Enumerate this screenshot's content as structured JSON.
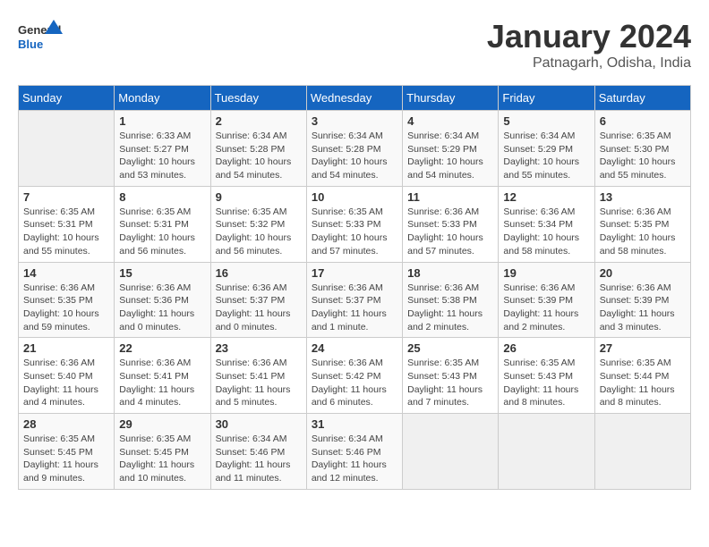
{
  "header": {
    "logo_general": "General",
    "logo_blue": "Blue",
    "month": "January 2024",
    "location": "Patnagarh, Odisha, India"
  },
  "days_of_week": [
    "Sunday",
    "Monday",
    "Tuesday",
    "Wednesday",
    "Thursday",
    "Friday",
    "Saturday"
  ],
  "weeks": [
    [
      {
        "num": "",
        "sunrise": "",
        "sunset": "",
        "daylight": ""
      },
      {
        "num": "1",
        "sunrise": "Sunrise: 6:33 AM",
        "sunset": "Sunset: 5:27 PM",
        "daylight": "Daylight: 10 hours and 53 minutes."
      },
      {
        "num": "2",
        "sunrise": "Sunrise: 6:34 AM",
        "sunset": "Sunset: 5:28 PM",
        "daylight": "Daylight: 10 hours and 54 minutes."
      },
      {
        "num": "3",
        "sunrise": "Sunrise: 6:34 AM",
        "sunset": "Sunset: 5:28 PM",
        "daylight": "Daylight: 10 hours and 54 minutes."
      },
      {
        "num": "4",
        "sunrise": "Sunrise: 6:34 AM",
        "sunset": "Sunset: 5:29 PM",
        "daylight": "Daylight: 10 hours and 54 minutes."
      },
      {
        "num": "5",
        "sunrise": "Sunrise: 6:34 AM",
        "sunset": "Sunset: 5:29 PM",
        "daylight": "Daylight: 10 hours and 55 minutes."
      },
      {
        "num": "6",
        "sunrise": "Sunrise: 6:35 AM",
        "sunset": "Sunset: 5:30 PM",
        "daylight": "Daylight: 10 hours and 55 minutes."
      }
    ],
    [
      {
        "num": "7",
        "sunrise": "Sunrise: 6:35 AM",
        "sunset": "Sunset: 5:31 PM",
        "daylight": "Daylight: 10 hours and 55 minutes."
      },
      {
        "num": "8",
        "sunrise": "Sunrise: 6:35 AM",
        "sunset": "Sunset: 5:31 PM",
        "daylight": "Daylight: 10 hours and 56 minutes."
      },
      {
        "num": "9",
        "sunrise": "Sunrise: 6:35 AM",
        "sunset": "Sunset: 5:32 PM",
        "daylight": "Daylight: 10 hours and 56 minutes."
      },
      {
        "num": "10",
        "sunrise": "Sunrise: 6:35 AM",
        "sunset": "Sunset: 5:33 PM",
        "daylight": "Daylight: 10 hours and 57 minutes."
      },
      {
        "num": "11",
        "sunrise": "Sunrise: 6:36 AM",
        "sunset": "Sunset: 5:33 PM",
        "daylight": "Daylight: 10 hours and 57 minutes."
      },
      {
        "num": "12",
        "sunrise": "Sunrise: 6:36 AM",
        "sunset": "Sunset: 5:34 PM",
        "daylight": "Daylight: 10 hours and 58 minutes."
      },
      {
        "num": "13",
        "sunrise": "Sunrise: 6:36 AM",
        "sunset": "Sunset: 5:35 PM",
        "daylight": "Daylight: 10 hours and 58 minutes."
      }
    ],
    [
      {
        "num": "14",
        "sunrise": "Sunrise: 6:36 AM",
        "sunset": "Sunset: 5:35 PM",
        "daylight": "Daylight: 10 hours and 59 minutes."
      },
      {
        "num": "15",
        "sunrise": "Sunrise: 6:36 AM",
        "sunset": "Sunset: 5:36 PM",
        "daylight": "Daylight: 11 hours and 0 minutes."
      },
      {
        "num": "16",
        "sunrise": "Sunrise: 6:36 AM",
        "sunset": "Sunset: 5:37 PM",
        "daylight": "Daylight: 11 hours and 0 minutes."
      },
      {
        "num": "17",
        "sunrise": "Sunrise: 6:36 AM",
        "sunset": "Sunset: 5:37 PM",
        "daylight": "Daylight: 11 hours and 1 minute."
      },
      {
        "num": "18",
        "sunrise": "Sunrise: 6:36 AM",
        "sunset": "Sunset: 5:38 PM",
        "daylight": "Daylight: 11 hours and 2 minutes."
      },
      {
        "num": "19",
        "sunrise": "Sunrise: 6:36 AM",
        "sunset": "Sunset: 5:39 PM",
        "daylight": "Daylight: 11 hours and 2 minutes."
      },
      {
        "num": "20",
        "sunrise": "Sunrise: 6:36 AM",
        "sunset": "Sunset: 5:39 PM",
        "daylight": "Daylight: 11 hours and 3 minutes."
      }
    ],
    [
      {
        "num": "21",
        "sunrise": "Sunrise: 6:36 AM",
        "sunset": "Sunset: 5:40 PM",
        "daylight": "Daylight: 11 hours and 4 minutes."
      },
      {
        "num": "22",
        "sunrise": "Sunrise: 6:36 AM",
        "sunset": "Sunset: 5:41 PM",
        "daylight": "Daylight: 11 hours and 4 minutes."
      },
      {
        "num": "23",
        "sunrise": "Sunrise: 6:36 AM",
        "sunset": "Sunset: 5:41 PM",
        "daylight": "Daylight: 11 hours and 5 minutes."
      },
      {
        "num": "24",
        "sunrise": "Sunrise: 6:36 AM",
        "sunset": "Sunset: 5:42 PM",
        "daylight": "Daylight: 11 hours and 6 minutes."
      },
      {
        "num": "25",
        "sunrise": "Sunrise: 6:35 AM",
        "sunset": "Sunset: 5:43 PM",
        "daylight": "Daylight: 11 hours and 7 minutes."
      },
      {
        "num": "26",
        "sunrise": "Sunrise: 6:35 AM",
        "sunset": "Sunset: 5:43 PM",
        "daylight": "Daylight: 11 hours and 8 minutes."
      },
      {
        "num": "27",
        "sunrise": "Sunrise: 6:35 AM",
        "sunset": "Sunset: 5:44 PM",
        "daylight": "Daylight: 11 hours and 8 minutes."
      }
    ],
    [
      {
        "num": "28",
        "sunrise": "Sunrise: 6:35 AM",
        "sunset": "Sunset: 5:45 PM",
        "daylight": "Daylight: 11 hours and 9 minutes."
      },
      {
        "num": "29",
        "sunrise": "Sunrise: 6:35 AM",
        "sunset": "Sunset: 5:45 PM",
        "daylight": "Daylight: 11 hours and 10 minutes."
      },
      {
        "num": "30",
        "sunrise": "Sunrise: 6:34 AM",
        "sunset": "Sunset: 5:46 PM",
        "daylight": "Daylight: 11 hours and 11 minutes."
      },
      {
        "num": "31",
        "sunrise": "Sunrise: 6:34 AM",
        "sunset": "Sunset: 5:46 PM",
        "daylight": "Daylight: 11 hours and 12 minutes."
      },
      {
        "num": "",
        "sunrise": "",
        "sunset": "",
        "daylight": ""
      },
      {
        "num": "",
        "sunrise": "",
        "sunset": "",
        "daylight": ""
      },
      {
        "num": "",
        "sunrise": "",
        "sunset": "",
        "daylight": ""
      }
    ]
  ]
}
